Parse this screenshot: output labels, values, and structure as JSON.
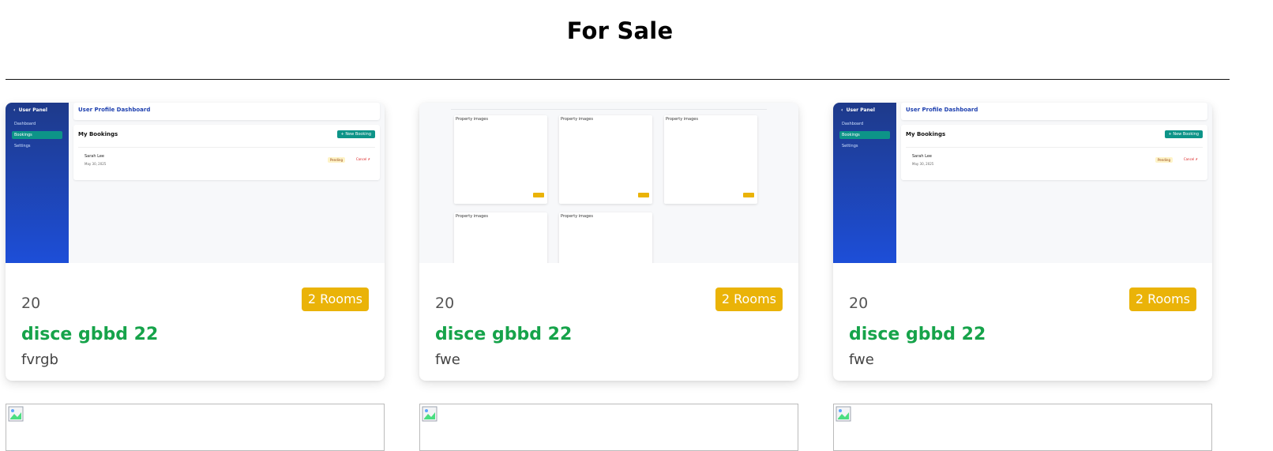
{
  "page": {
    "title": "For Sale"
  },
  "cards": [
    {
      "price": "20",
      "rooms": "2 Rooms",
      "title": "disce gbbd 22",
      "description": "fvrgb",
      "thumbnail": {
        "panel_title": "User Panel",
        "nav": [
          "Dashboard",
          "Bookings",
          "Settings"
        ],
        "header": "User Profile Dashboard",
        "section": "My Bookings",
        "new_button": "+ New Booking",
        "booking_name": "Sarah Lee",
        "booking_date": "May 30, 2025",
        "status": "Pending",
        "cancel": "Cancel ✗"
      }
    },
    {
      "price": "20",
      "rooms": "2 Rooms",
      "title": "disce gbbd 22",
      "description": "fwe",
      "thumbnail": {
        "image_alts": [
          "Property images",
          "Property images",
          "Property images",
          "Property images",
          "Property images"
        ]
      }
    },
    {
      "price": "20",
      "rooms": "2 Rooms",
      "title": "disce gbbd 22",
      "description": "fwe",
      "thumbnail": {
        "panel_title": "User Panel",
        "nav": [
          "Dashboard",
          "Bookings",
          "Settings"
        ],
        "header": "User Profile Dashboard",
        "section": "My Bookings",
        "new_button": "+ New Booking",
        "booking_name": "Sarah Lee",
        "booking_date": "May 30, 2025",
        "status": "Pending",
        "cancel": "Cancel ✗"
      }
    }
  ],
  "colors": {
    "badge": "#eab308",
    "title_green": "#16a34a",
    "sidebar": "#1d4ed8",
    "accent_teal": "#0d9488"
  },
  "icons": {
    "broken_image": "broken-image-icon"
  }
}
